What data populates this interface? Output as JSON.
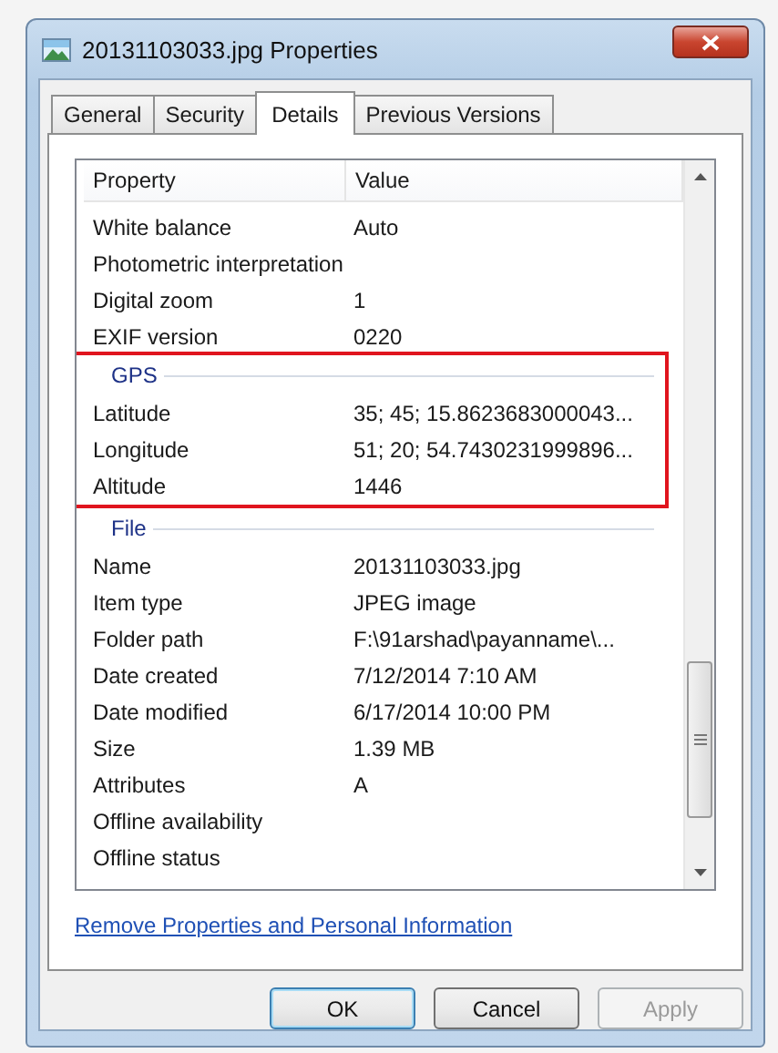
{
  "window": {
    "title": "20131103033.jpg Properties"
  },
  "tabs": [
    {
      "label": "General",
      "selected": false
    },
    {
      "label": "Security",
      "selected": false
    },
    {
      "label": "Details",
      "selected": true
    },
    {
      "label": "Previous Versions",
      "selected": false
    }
  ],
  "properties": {
    "columns": [
      "Property",
      "Value"
    ],
    "rows": [
      {
        "property": "White balance",
        "value": "Auto"
      },
      {
        "property": "Photometric interpretation",
        "value": ""
      },
      {
        "property": "Digital zoom",
        "value": "1"
      },
      {
        "property": "EXIF version",
        "value": "0220"
      }
    ],
    "groups": [
      {
        "label": "GPS",
        "highlighted": true,
        "rows": [
          {
            "property": "Latitude",
            "value": "35; 45; 15.8623683000043..."
          },
          {
            "property": "Longitude",
            "value": "51; 20; 54.7430231999896..."
          },
          {
            "property": "Altitude",
            "value": "1446"
          }
        ]
      },
      {
        "label": "File",
        "highlighted": false,
        "rows": [
          {
            "property": "Name",
            "value": "20131103033.jpg"
          },
          {
            "property": "Item type",
            "value": "JPEG image"
          },
          {
            "property": "Folder path",
            "value": "F:\\91arshad\\payanname\\..."
          },
          {
            "property": "Date created",
            "value": "7/12/2014 7:10 AM"
          },
          {
            "property": "Date modified",
            "value": "6/17/2014 10:00 PM"
          },
          {
            "property": "Size",
            "value": "1.39 MB"
          },
          {
            "property": "Attributes",
            "value": "A"
          },
          {
            "property": "Offline availability",
            "value": ""
          },
          {
            "property": "Offline status",
            "value": ""
          }
        ]
      }
    ]
  },
  "link": "Remove Properties and Personal Information",
  "buttons": [
    {
      "label": "OK",
      "default": true,
      "disabled": false
    },
    {
      "label": "Cancel",
      "default": false,
      "disabled": false
    },
    {
      "label": "Apply",
      "default": false,
      "disabled": true
    }
  ]
}
